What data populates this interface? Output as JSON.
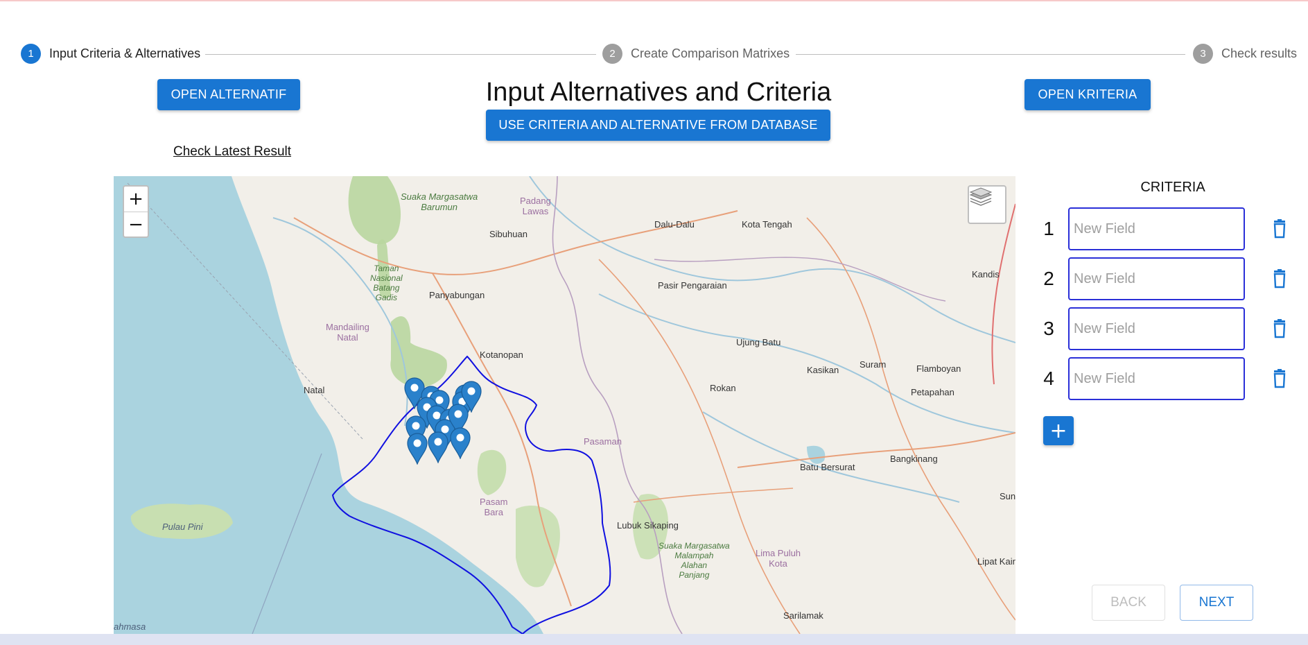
{
  "stepper": {
    "steps": [
      {
        "number": "1",
        "label": "Input Criteria & Alternatives"
      },
      {
        "number": "2",
        "label": "Create Comparison Matrixes"
      },
      {
        "number": "3",
        "label": "Check results"
      }
    ]
  },
  "header": {
    "title": "Input Alternatives and Criteria",
    "open_alternatif_label": "OPEN ALTERNATIF",
    "open_kriteria_label": "OPEN KRITERIA",
    "use_db_label": "USE CRITERIA AND ALTERNATIVE FROM DATABASE",
    "check_latest_label": "Check Latest Result"
  },
  "map": {
    "zoom_in": "+",
    "zoom_out": "−",
    "labels": {
      "suaka_barumun": "Suaka Margasatwa\nBarumun",
      "padang_lawas": "Padang\nLawas",
      "sibuhuan": "Sibuhuan",
      "dalu_dalu": "Dalu-Dalu",
      "kota_tengah": "Kota Tengah",
      "kandis": "Kandis",
      "taman_nasional": "Taman\nNasional\nBatang\nGadis",
      "panyabungan": "Panyabungan",
      "pasir_pengaraian": "Pasir Pengaraian",
      "mandailing_natal": "Mandailing\nNatal",
      "ujung_batu": "Ujung Batu",
      "kotanopan": "Kotanopan",
      "kasikan": "Kasikan",
      "suram": "Suram",
      "flamboyan": "Flamboyan",
      "natal": "Natal",
      "rokan": "Rokan",
      "petapahan": "Petapahan",
      "pasaman": "Pasaman",
      "batu_bersurat": "Batu Bersurat",
      "bangkinang": "Bangkinang",
      "sun": "Sun",
      "pulau_pini": "Pulau Pini",
      "pasaman_barat": "Pasam\nBara",
      "lubuk_sikaping": "Lubuk Sikaping",
      "suaka_malampah": "Suaka Margasatwa\nMalampah\nAlahan\nPanjang",
      "lima_puluh_kota": "Lima Puluh\nKota",
      "lipat_kain": "Lipat Kain",
      "sarilamak": "Sarilamak",
      "ahmasa": "ahmasa"
    }
  },
  "criteria": {
    "title": "CRITERIA",
    "items": [
      {
        "number": "1",
        "value": "",
        "placeholder": "New Field"
      },
      {
        "number": "2",
        "value": "",
        "placeholder": "New Field"
      },
      {
        "number": "3",
        "value": "",
        "placeholder": "New Field"
      },
      {
        "number": "4",
        "value": "",
        "placeholder": "New Field"
      }
    ],
    "add_label": "+"
  },
  "navigation": {
    "back_label": "BACK",
    "next_label": "NEXT"
  },
  "colors": {
    "primary": "#1976d2",
    "input_border": "#2a2fd8",
    "water": "#aad3df",
    "land": "#f2efe9",
    "park": "#c8dfb1",
    "boundary": "#1010e0",
    "marker": "#2a81cb"
  }
}
